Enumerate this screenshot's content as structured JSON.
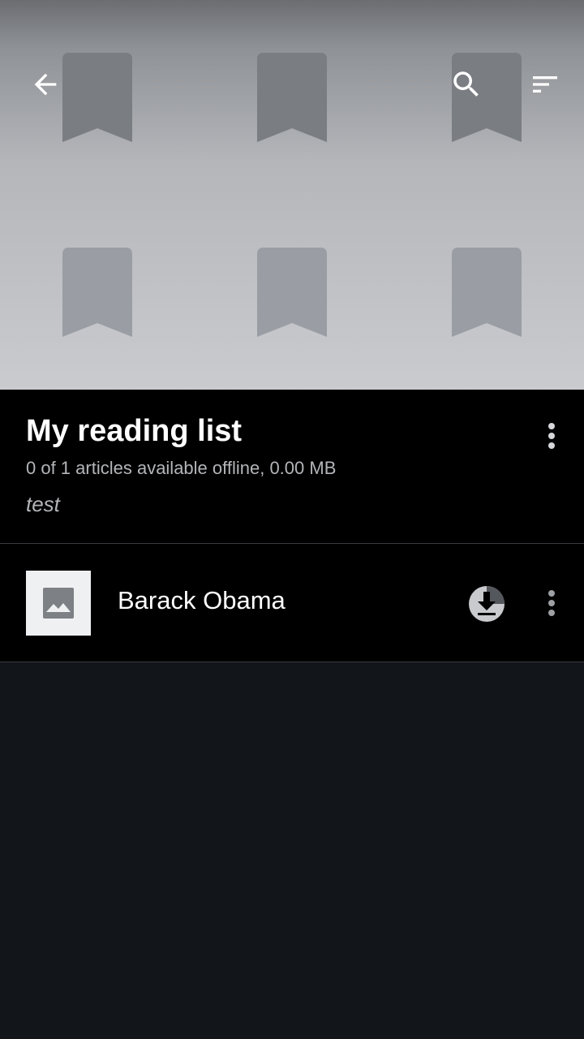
{
  "toolbar": {
    "back_icon": "arrow-back-icon",
    "search_icon": "search-icon",
    "sort_icon": "sort-icon"
  },
  "hero": {
    "decoration_icon": "bookmark-icon"
  },
  "reading_list": {
    "title": "My reading list",
    "subtitle": "0 of 1 articles available offline, 0.00 MB",
    "description": "test",
    "menu_icon": "more-vert-icon"
  },
  "articles": [
    {
      "title": "Barack Obama",
      "thumbnail_icon": "image-placeholder-icon",
      "download_icon": "download-icon",
      "menu_icon": "more-vert-icon"
    }
  ],
  "colors": {
    "background": "#12151a",
    "header_background": "#000000",
    "secondary_text": "#b3b5b9",
    "bookmark_fill": "#9a9ea4"
  }
}
